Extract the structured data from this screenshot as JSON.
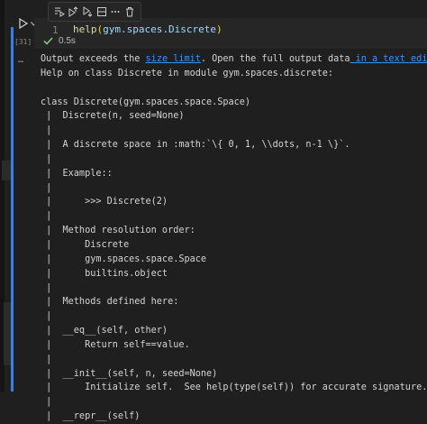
{
  "cell": {
    "exec_count": "[31]",
    "line_number": "1",
    "code": {
      "fn": "help",
      "open_paren": "(",
      "arg": "gym.spaces.Discrete",
      "close_paren": ")"
    },
    "status_time": "0.5s",
    "output_menu": "…"
  },
  "toolbar": {
    "items": [
      "run-by-line",
      "execute-above",
      "execute-below",
      "split-cell",
      "more",
      "delete"
    ]
  },
  "output": {
    "notice_prefix": "Output exceeds the ",
    "size_limit_link": "size limit",
    "notice_middle": ". Open the full output data",
    "text_editor_link": " in a text editor",
    "lines": [
      "Help on class Discrete in module gym.spaces.discrete:",
      "",
      "class Discrete(gym.spaces.space.Space)",
      " |  Discrete(n, seed=None)",
      " |  ",
      " |  A discrete space in :math:`\\{ 0, 1, \\\\dots, n-1 \\}`.",
      " |  ",
      " |  Example::",
      " |  ",
      " |      >>> Discrete(2)",
      " |  ",
      " |  Method resolution order:",
      " |      Discrete",
      " |      gym.spaces.space.Space",
      " |      builtins.object",
      " |  ",
      " |  Methods defined here:",
      " |  ",
      " |  __eq__(self, other)",
      " |      Return self==value.",
      " |  ",
      " |  __init__(self, n, seed=None)",
      " |      Initialize self.  See help(type(self)) for accurate signature.",
      " |  ",
      " |  __repr__(self)"
    ]
  },
  "colors": {
    "accent": "#3794ff",
    "success": "#89d185",
    "background": "#1f1f1f"
  }
}
